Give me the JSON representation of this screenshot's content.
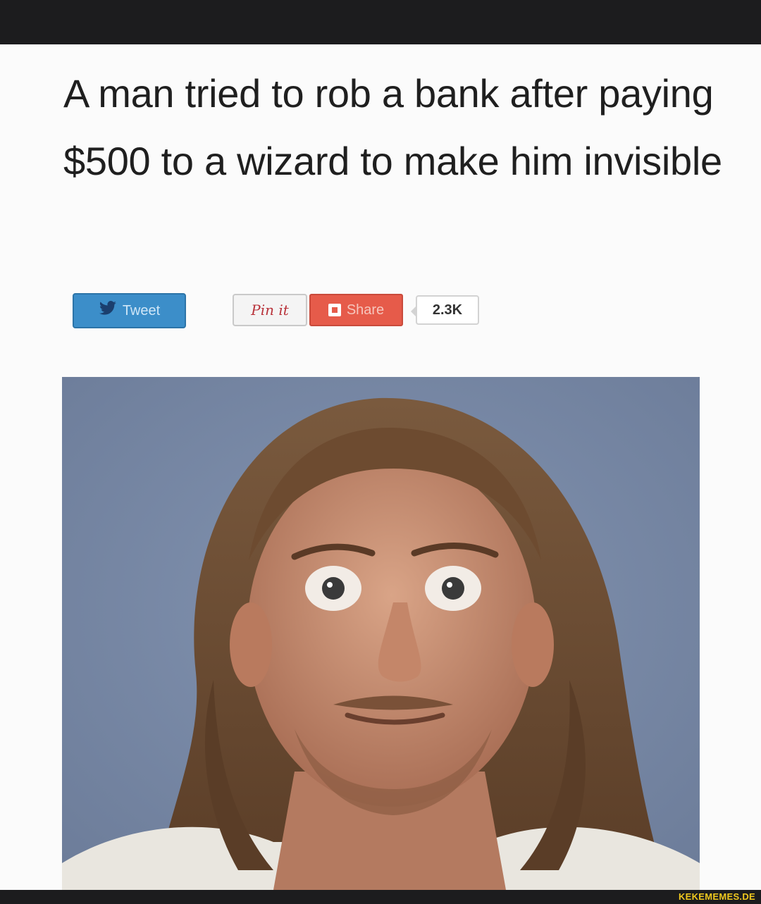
{
  "article": {
    "headline": "A man tried to rob a bank after paying $500 to a wizard to make him invisible"
  },
  "share": {
    "tweet_label": "Tweet",
    "pin_label": "Pin it",
    "share_label": "Share",
    "share_count": "2.3K"
  },
  "watermark": "KEKEMEMES.DE",
  "colors": {
    "tweet": "#3c8ec9",
    "share": "#e65b4a",
    "pin_text": "#b8323a",
    "watermark": "#f0c81e"
  },
  "icons": [
    "twitter-bird-icon",
    "share-square-icon"
  ]
}
